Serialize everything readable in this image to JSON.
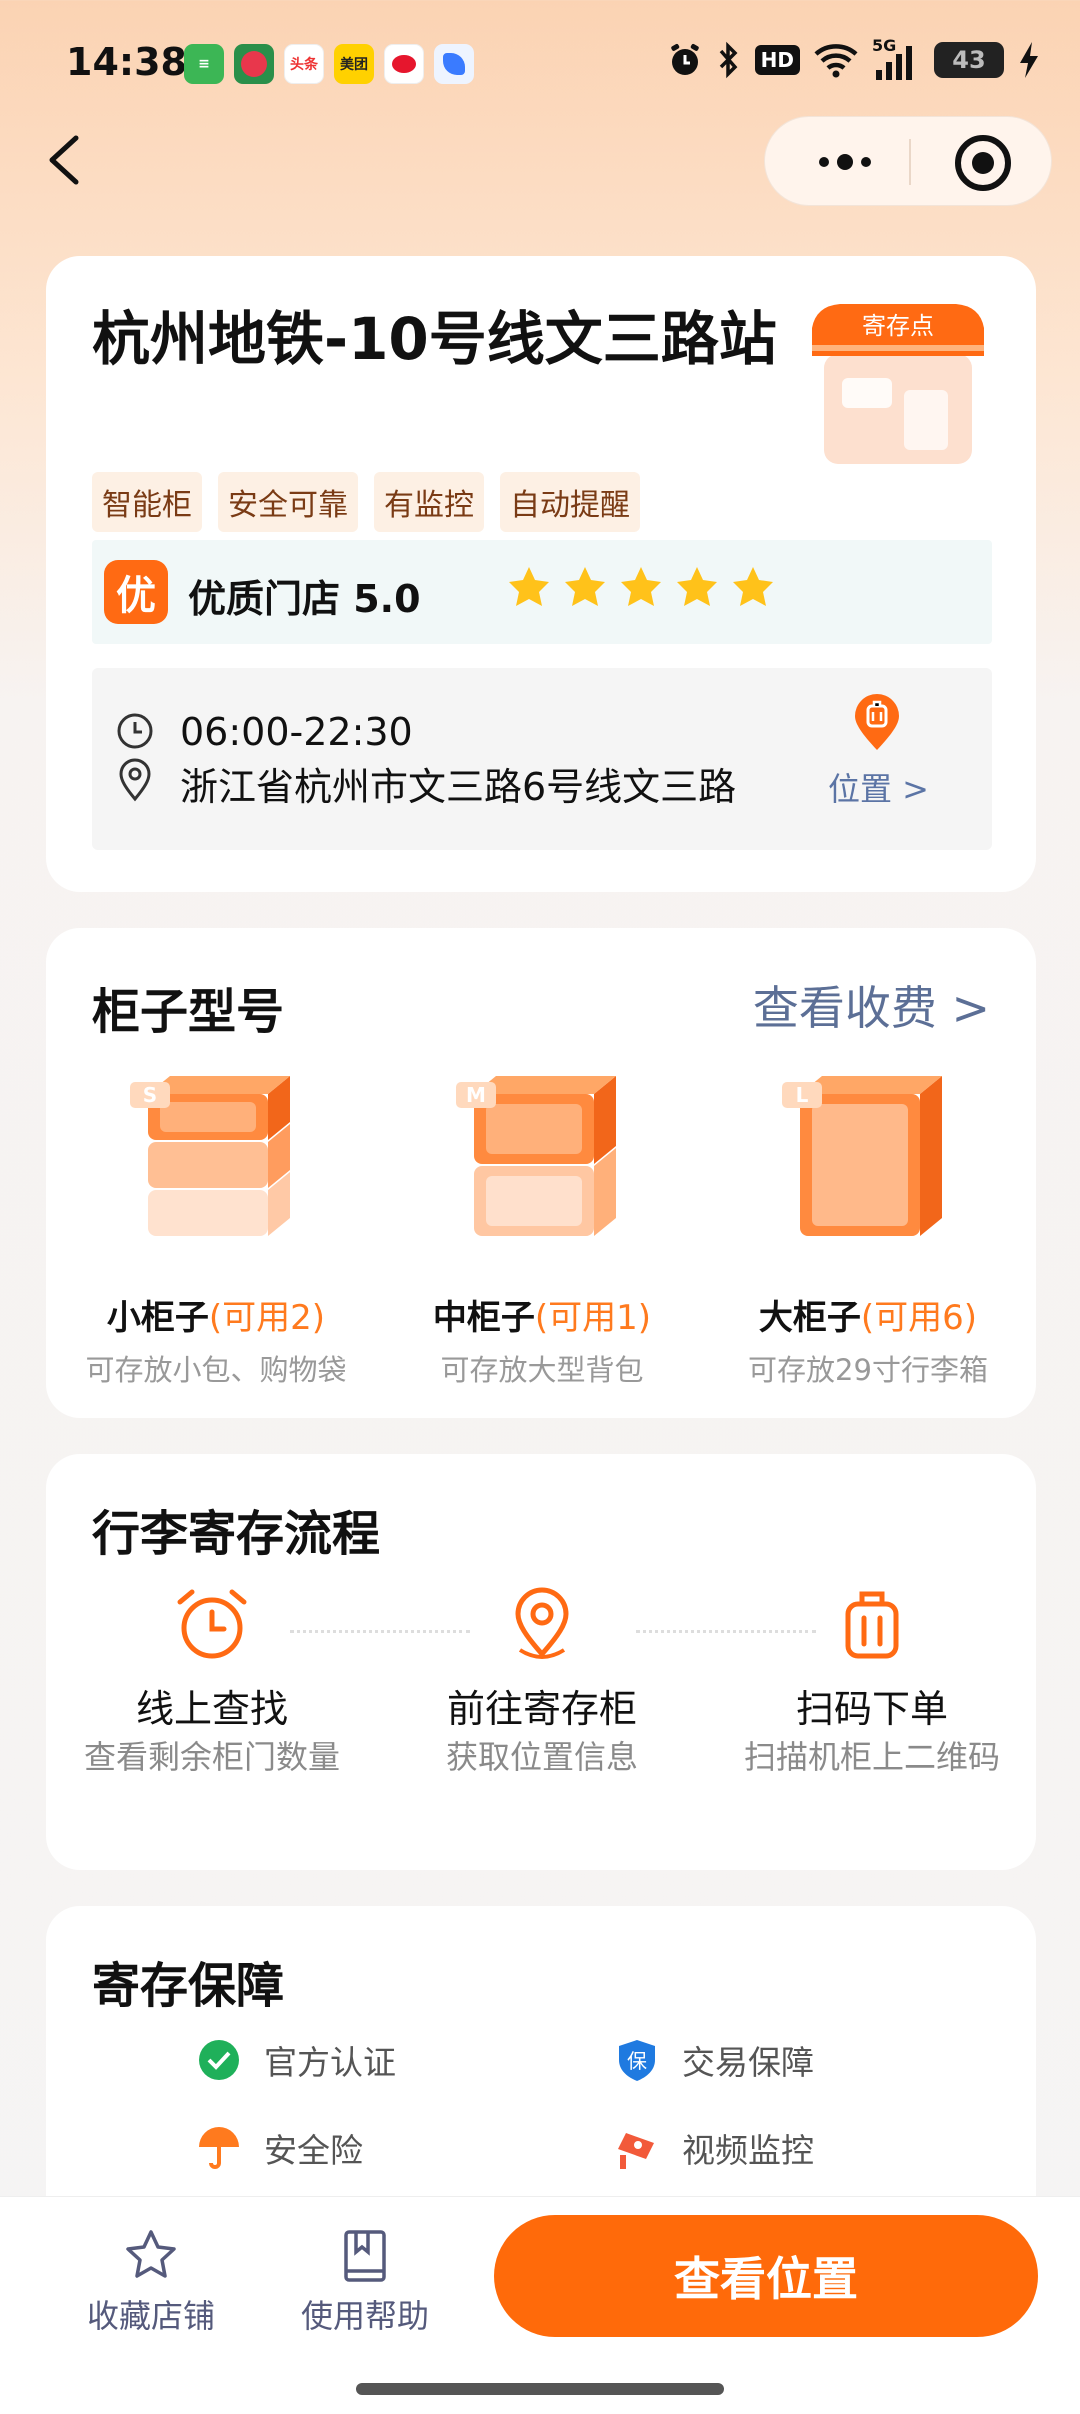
{
  "status_bar": {
    "time": "14:38",
    "notif_icons": [
      "消息",
      "荔枝",
      "头条",
      "美团",
      "微博",
      "翼"
    ],
    "hd": "HD",
    "signal": "5G",
    "battery": "43"
  },
  "store": {
    "name": "杭州地铁-10号线文三路站",
    "shop_sign": "寄存点",
    "tags": [
      "智能柜",
      "安全可靠",
      "有监控",
      "自动提醒"
    ],
    "quality_badge": "优",
    "quality_text": "优质门店 5.0",
    "stars": 5,
    "hours": "06:00-22:30",
    "address": "浙江省杭州市文三路6号线文三路",
    "location_link": "位置 >"
  },
  "cabinets": {
    "title": "柜子型号",
    "fee_link": "查看收费 >",
    "items": [
      {
        "size": "S",
        "name": "小柜子",
        "avail": "(可用2)",
        "desc": "可存放小包、购物袋"
      },
      {
        "size": "M",
        "name": "中柜子",
        "avail": "(可用1)",
        "desc": "可存放大型背包"
      },
      {
        "size": "L",
        "name": "大柜子",
        "avail": "(可用6)",
        "desc": "可存放29寸行李箱"
      }
    ]
  },
  "process": {
    "title": "行李寄存流程",
    "steps": [
      {
        "title": "线上查找",
        "desc": "查看剩余柜门数量",
        "icon": "alarm-clock-icon"
      },
      {
        "title": "前往寄存柜",
        "desc": "获取位置信息",
        "icon": "location-pin-icon"
      },
      {
        "title": "扫码下单",
        "desc": "扫描机柜上二维码",
        "icon": "luggage-icon"
      }
    ]
  },
  "guarantee": {
    "title": "寄存保障",
    "items": [
      {
        "label": "官方认证",
        "icon": "verified-icon",
        "color": "#1fb05a"
      },
      {
        "label": "交易保障",
        "icon": "shield-icon",
        "color": "#1f7ae0",
        "glyph": "保"
      },
      {
        "label": "安全险",
        "icon": "umbrella-icon",
        "color": "#ff7a1e"
      },
      {
        "label": "视频监控",
        "icon": "camera-icon",
        "color": "#f25a3a"
      }
    ]
  },
  "bottom_bar": {
    "favorite": "收藏店铺",
    "help": "使用帮助",
    "cta": "查看位置"
  },
  "colors": {
    "accent": "#ff6a0a",
    "link": "#5c6f96",
    "avail": "#ff7a1e"
  }
}
